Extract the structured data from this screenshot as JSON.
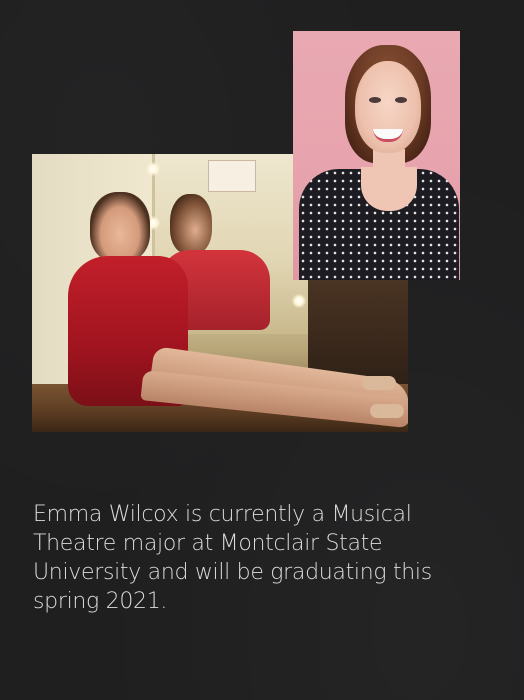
{
  "bio": {
    "text": "Emma Wilcox is currently a Musical Theatre major at Montclair State University and will be graduating this spring 2021."
  },
  "photos": {
    "dressing_room": {
      "sign_text": "..."
    }
  },
  "colors": {
    "background": "#1f1f20",
    "text": "#dcdcdc",
    "headshot_backdrop": "#e7a3ad",
    "dress_red": "#b31a24"
  }
}
